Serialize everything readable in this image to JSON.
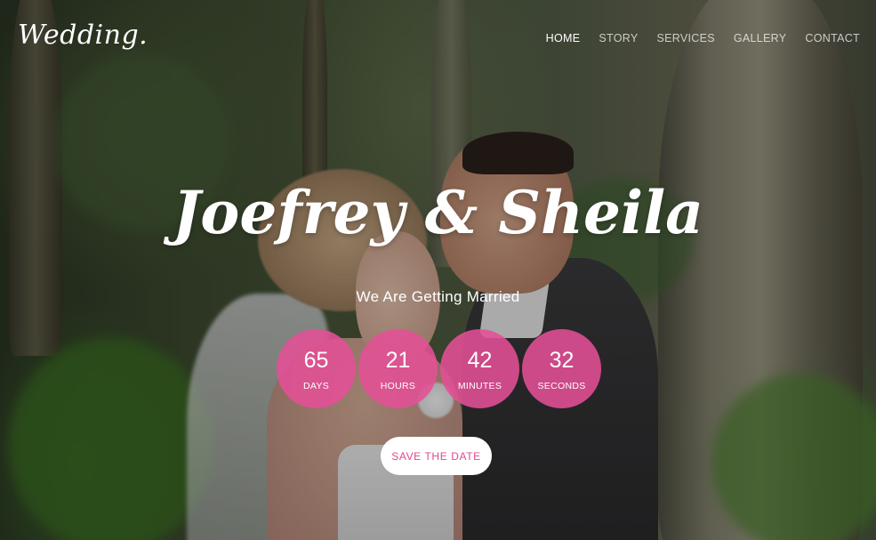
{
  "brand": {
    "logo": "Wedding."
  },
  "nav": {
    "items": [
      {
        "label": "HOME",
        "active": true
      },
      {
        "label": "STORY",
        "active": false
      },
      {
        "label": "SERVICES",
        "active": false
      },
      {
        "label": "GALLERY",
        "active": false
      },
      {
        "label": "CONTACT",
        "active": false
      }
    ]
  },
  "hero": {
    "names": "Joefrey & Sheila",
    "tagline": "We Are Getting Married",
    "countdown": [
      {
        "value": "65",
        "unit": "DAYS"
      },
      {
        "value": "21",
        "unit": "HOURS"
      },
      {
        "value": "42",
        "unit": "MINUTES"
      },
      {
        "value": "32",
        "unit": "SECONDS"
      }
    ],
    "cta_label": "SAVE THE DATE"
  },
  "colors": {
    "accent": "#e4509a",
    "cta_text": "#e0488f",
    "text": "#ffffff"
  }
}
